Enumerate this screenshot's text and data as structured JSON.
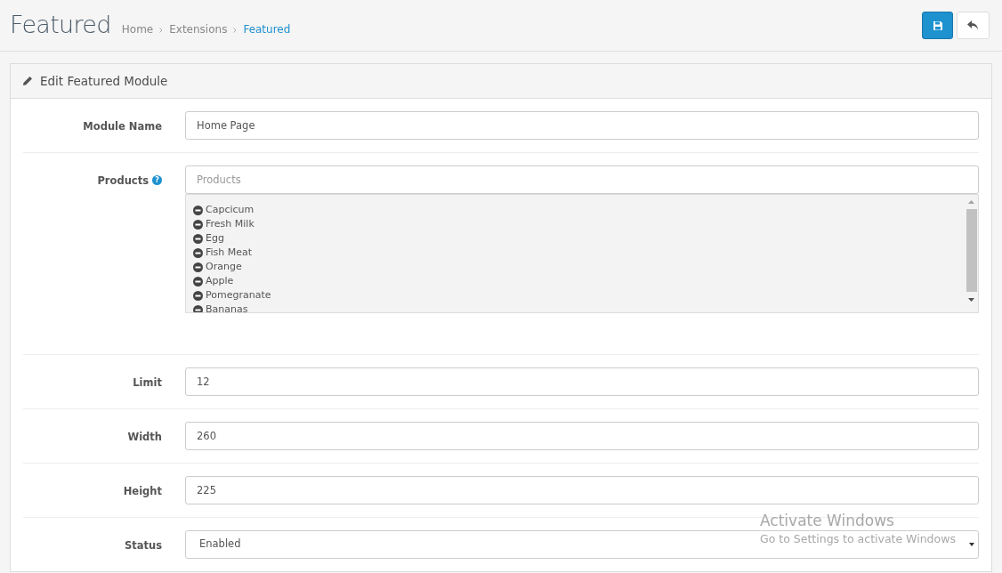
{
  "page": {
    "title": "Featured",
    "breadcrumb": [
      {
        "label": "Home",
        "selected": false
      },
      {
        "label": "Extensions",
        "selected": false
      },
      {
        "label": "Featured",
        "selected": true
      }
    ]
  },
  "panel": {
    "title": "Edit Featured Module",
    "fields": [
      {
        "kind": "text",
        "label": "Module Name",
        "value": "Home Page"
      },
      {
        "kind": "autocomplete",
        "label": "Products",
        "help": "?",
        "placeholder": "Products",
        "items": [
          "Capcicum",
          "Fresh Milk",
          "Egg",
          "Fish Meat",
          "Orange",
          "Apple",
          "Pomegranate",
          "Bananas"
        ]
      },
      {
        "kind": "text",
        "label": "Limit",
        "value": "12"
      },
      {
        "kind": "text",
        "label": "Width",
        "value": "260"
      },
      {
        "kind": "text",
        "label": "Height",
        "value": "225"
      },
      {
        "kind": "select",
        "label": "Status",
        "value": "Enabled"
      }
    ]
  },
  "os_notice": {
    "title": "Activate Windows",
    "message": "Go to Settings to activate Windows"
  }
}
